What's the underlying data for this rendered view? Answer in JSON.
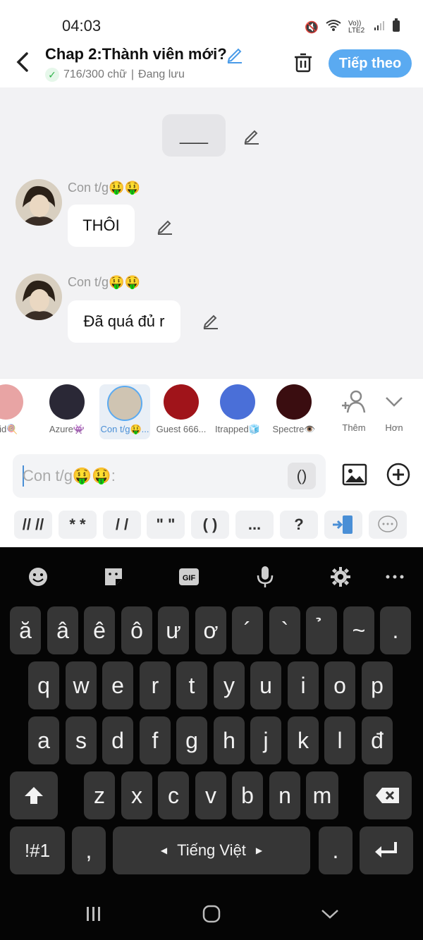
{
  "status": {
    "time": "04:03",
    "network": "Vo)) LTE2"
  },
  "header": {
    "title": "Chap 2:Thành viên mới?",
    "word_count": "716/300 chữ",
    "save_state": "Đang lưu",
    "next_label": "Tiếp theo"
  },
  "chat": {
    "placeholder_text": "___",
    "messages": [
      {
        "speaker": "Con t/g🤑🤑",
        "text": "THÔI"
      },
      {
        "speaker": "Con t/g🤑🤑",
        "text": "Đã quá đủ r"
      }
    ]
  },
  "characters": {
    "items": [
      {
        "name": "Kid🍭"
      },
      {
        "name": "Azure👾"
      },
      {
        "name": "Con t/g🤑..."
      },
      {
        "name": "Guest 666..."
      },
      {
        "name": "Itrapped🧊"
      },
      {
        "name": "Spectre👁️"
      }
    ],
    "more_label": "Thêm",
    "expand_label": "Hơn"
  },
  "input": {
    "placeholder": "Con t/g🤑🤑:",
    "paren_label": "()"
  },
  "shortcuts": [
    "// //",
    "* *",
    "/ /",
    "\" \"",
    "( )",
    "...",
    "?"
  ],
  "keyboard": {
    "row0": [
      "ă",
      "â",
      "ê",
      "ô",
      "ư",
      "ơ",
      "´",
      "`",
      "̉",
      "~",
      "."
    ],
    "row1": [
      "q",
      "w",
      "e",
      "r",
      "t",
      "y",
      "u",
      "i",
      "o",
      "p"
    ],
    "row2": [
      "a",
      "s",
      "d",
      "f",
      "g",
      "h",
      "j",
      "k",
      "l",
      "đ"
    ],
    "row3": [
      "z",
      "x",
      "c",
      "v",
      "b",
      "n",
      "m"
    ],
    "sym_label": "!#1",
    "comma": ",",
    "space_label": "Tiếng Việt",
    "period": "."
  },
  "colors": {
    "accent": "#5aaaf1",
    "chat_bg": "#f2f2f4",
    "keyboard_bg": "#050505",
    "key_bg": "#363636"
  }
}
